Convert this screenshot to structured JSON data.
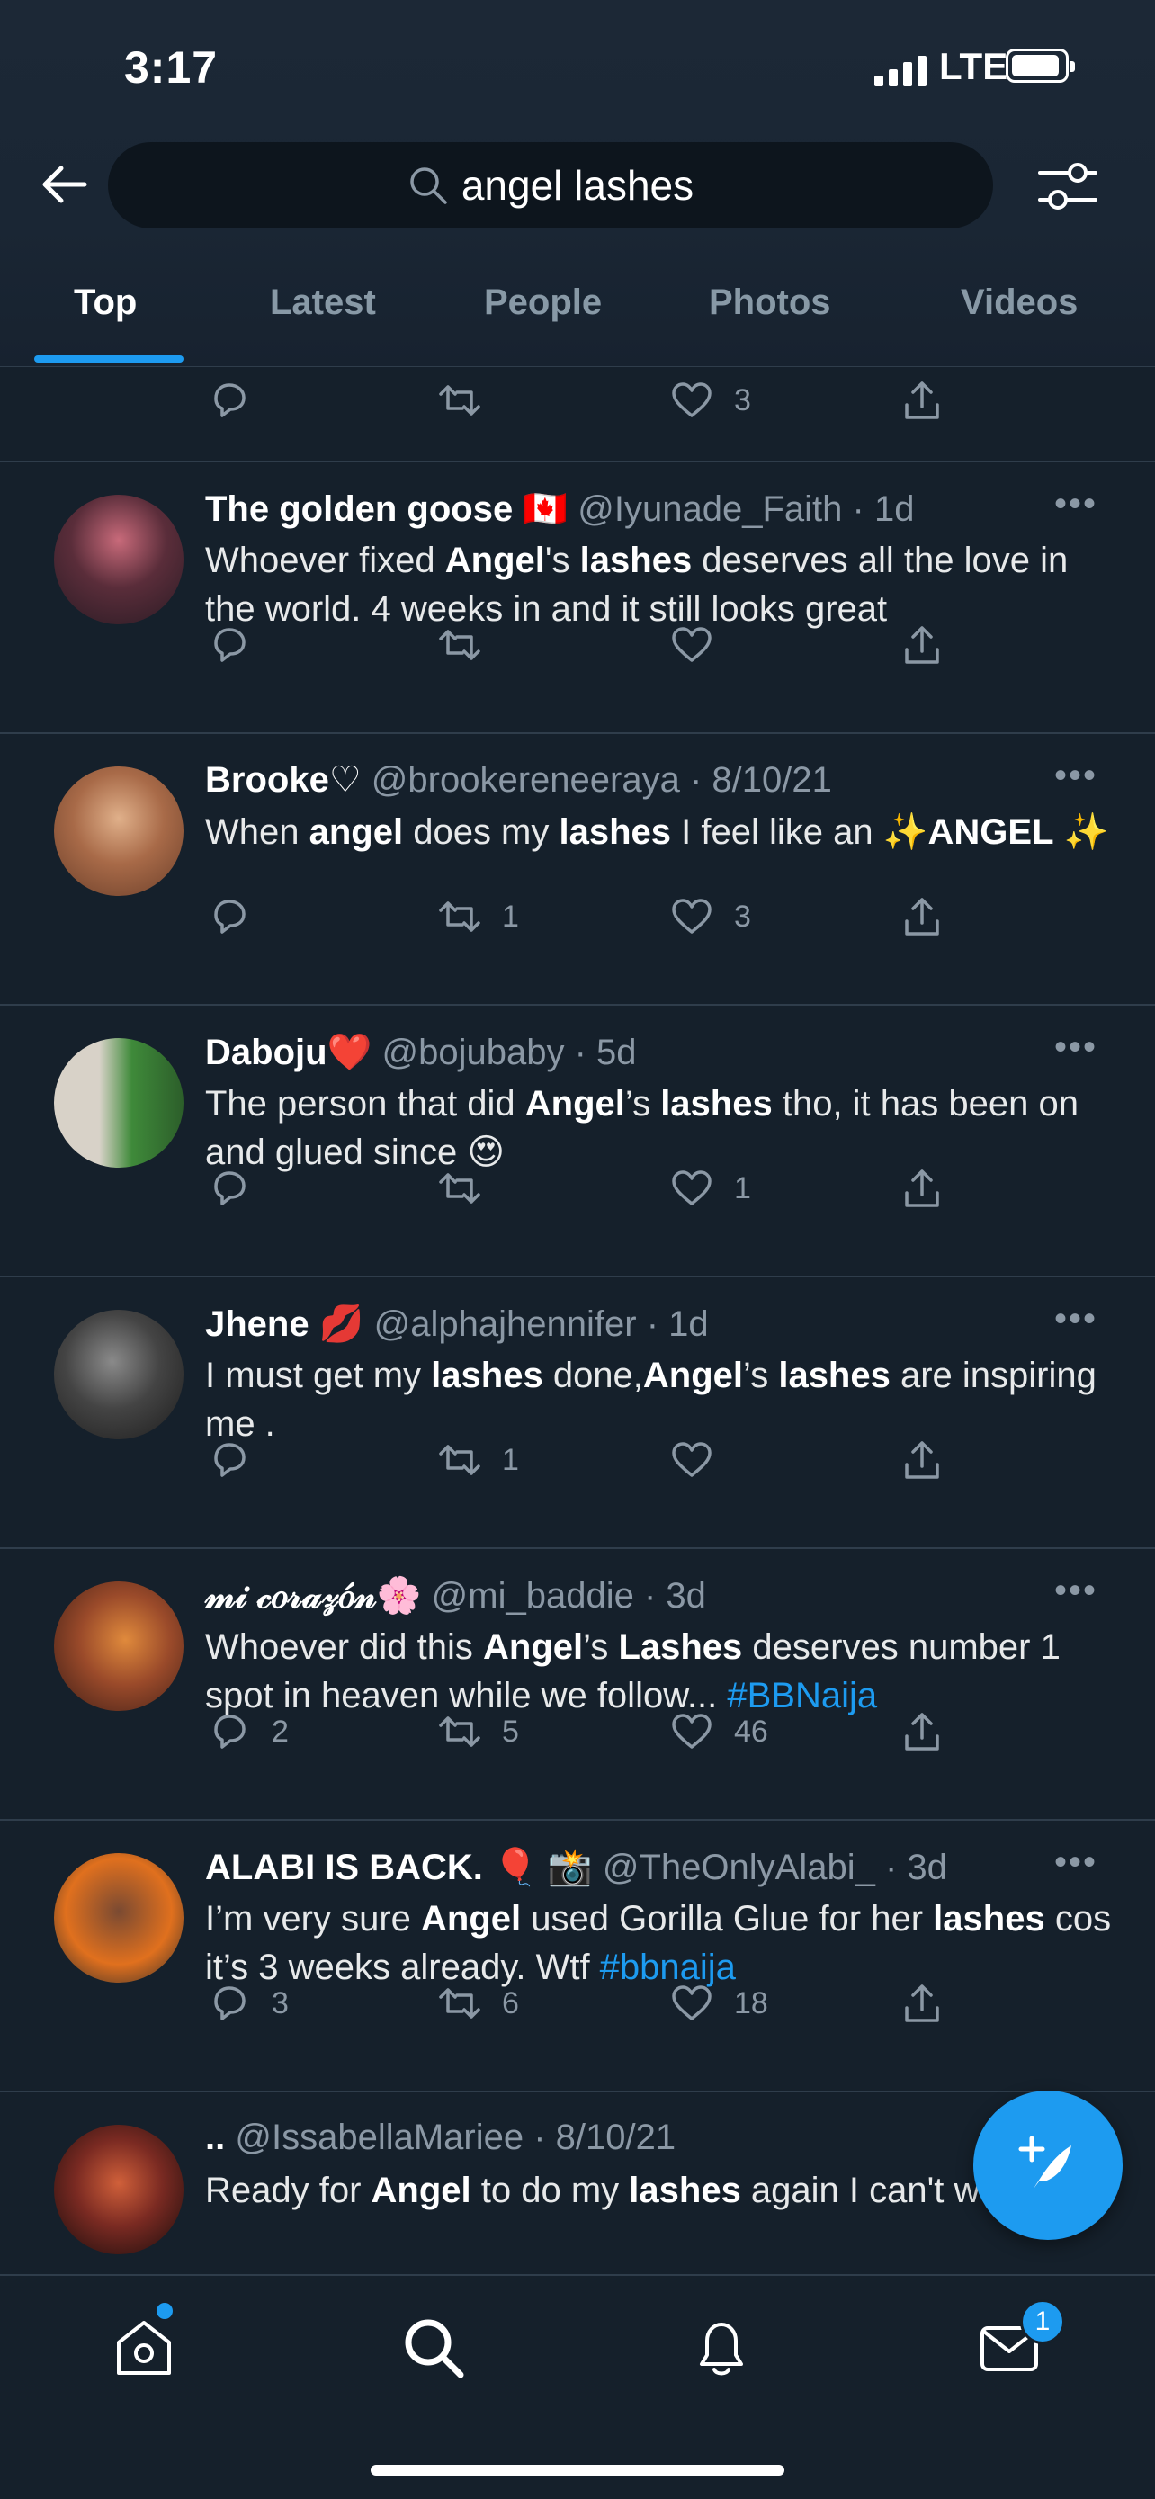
{
  "status_bar": {
    "time": "3:17",
    "network": "LTE"
  },
  "search": {
    "query": "angel lashes"
  },
  "tabs": [
    {
      "label": "Top",
      "active": true
    },
    {
      "label": "Latest",
      "active": false
    },
    {
      "label": "People",
      "active": false
    },
    {
      "label": "Photos",
      "active": false
    },
    {
      "label": "Videos",
      "active": false
    }
  ],
  "top_actions": {
    "retweets": "",
    "likes": "3"
  },
  "tweets": [
    {
      "name": "The golden goose 🇨🇦",
      "handle": "@Iyunade_Faith",
      "time": "1d",
      "text_html": "Whoever fixed <b>Angel</b>'s <b>lashes</b> deserves all the love in the world. 4 weeks in and it still looks great",
      "replies": "",
      "retweets": "",
      "likes": ""
    },
    {
      "name": "Brooke♡",
      "handle": "@brookereneeraya",
      "time": "8/10/21",
      "text_html": "When <b>angel</b> does my <b>lashes</b> I feel like an ✨<b>ANGEL</b> ✨",
      "replies": "",
      "retweets": "1",
      "likes": "3"
    },
    {
      "name": "Daboju❤️",
      "handle": "@bojubaby",
      "time": "5d",
      "text_html": "The person that did <b>Angel</b>’s <b>lashes</b> tho, it has been on and glued since 😍",
      "replies": "",
      "retweets": "",
      "likes": "1"
    },
    {
      "name": "Jhene 💋",
      "handle": "@alphajhennifer",
      "time": "1d",
      "text_html": "I must get my <b>lashes</b> done,<b>Angel</b>’s <b>lashes</b> are inspiring me .",
      "replies": "",
      "retweets": "1",
      "likes": ""
    },
    {
      "name": "𝓂𝒾 𝒸𝑜𝓇𝒶𝓏𝑜́𝓃🌸",
      "handle": "@mi_baddie",
      "time": "3d",
      "text_html": "Whoever did this <b>Angel</b>’s <b>Lashes</b> deserves  number 1 spot in heaven while we follow... <span class=\"tag\">#BBNaija</span>",
      "replies": "2",
      "retweets": "5",
      "likes": "46"
    },
    {
      "name": "ALABI IS BACK. 🎈 📸",
      "handle": "@TheOnlyAlabi_",
      "time": "3d",
      "text_html": "I’m very sure <b>Angel</b> used Gorilla Glue for her <b>lashes</b> cos it’s 3 weeks already. Wtf <span class=\"tag\">#bbnaija</span>",
      "replies": "3",
      "retweets": "6",
      "likes": "18"
    },
    {
      "name": "..",
      "handle": "@IssabellaMariee",
      "time": "8/10/21",
      "text_html": "Ready for <b>Angel</b> to do my <b>lashes</b> again I can't wait more",
      "replies": "",
      "retweets": "",
      "likes": ""
    }
  ],
  "bottom_nav": {
    "messages_badge": "1"
  },
  "colors": {
    "background": "#15202b",
    "accent": "#1d9bf0",
    "muted": "#8b98a5",
    "divider": "#2f3d4b"
  }
}
